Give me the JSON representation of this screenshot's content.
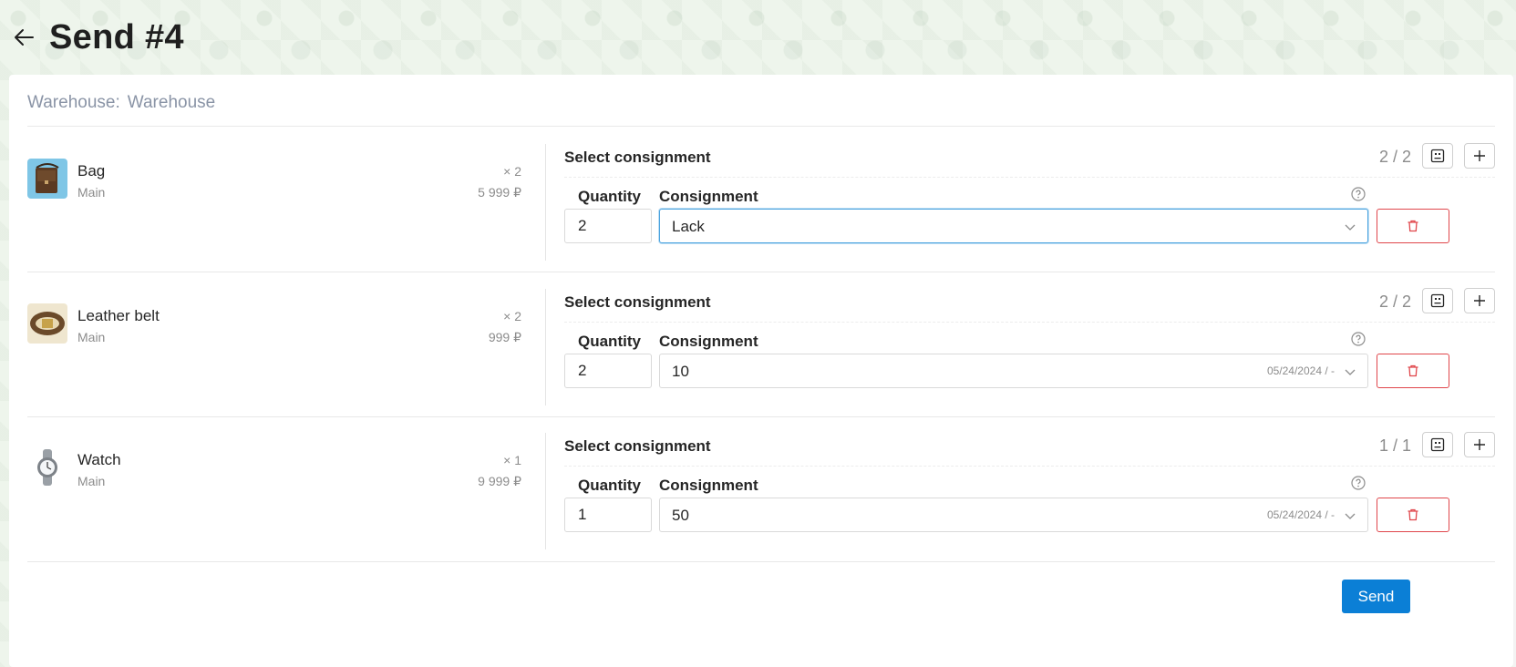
{
  "header": {
    "title": "Send #4",
    "back_icon": "arrow-left-icon"
  },
  "warehouse": {
    "label": "Warehouse:",
    "value": "Warehouse"
  },
  "items": [
    {
      "name": "Bag",
      "category": "Main",
      "qty": "× 2",
      "price": "5 999 ₽",
      "consignment": {
        "title": "Select consignment",
        "count": "2 / 2",
        "quantity_label": "Quantity",
        "consignment_label": "Consignment",
        "quantity_value": "2",
        "selected": "Lack",
        "date": ""
      }
    },
    {
      "name": "Leather belt",
      "category": "Main",
      "qty": "× 2",
      "price": "999 ₽",
      "consignment": {
        "title": "Select consignment",
        "count": "2 / 2",
        "quantity_label": "Quantity",
        "consignment_label": "Consignment",
        "quantity_value": "2",
        "selected": "10",
        "date": "05/24/2024 / -"
      }
    },
    {
      "name": "Watch",
      "category": "Main",
      "qty": "× 1",
      "price": "9 999 ₽",
      "consignment": {
        "title": "Select consignment",
        "count": "1 / 1",
        "quantity_label": "Quantity",
        "consignment_label": "Consignment",
        "quantity_value": "1",
        "selected": "50",
        "date": "05/24/2024 / -"
      }
    }
  ],
  "actions": {
    "send_label": "Send"
  },
  "colors": {
    "primary": "#0b7fd6",
    "danger": "#e0464b",
    "focus": "#4aa3df"
  }
}
